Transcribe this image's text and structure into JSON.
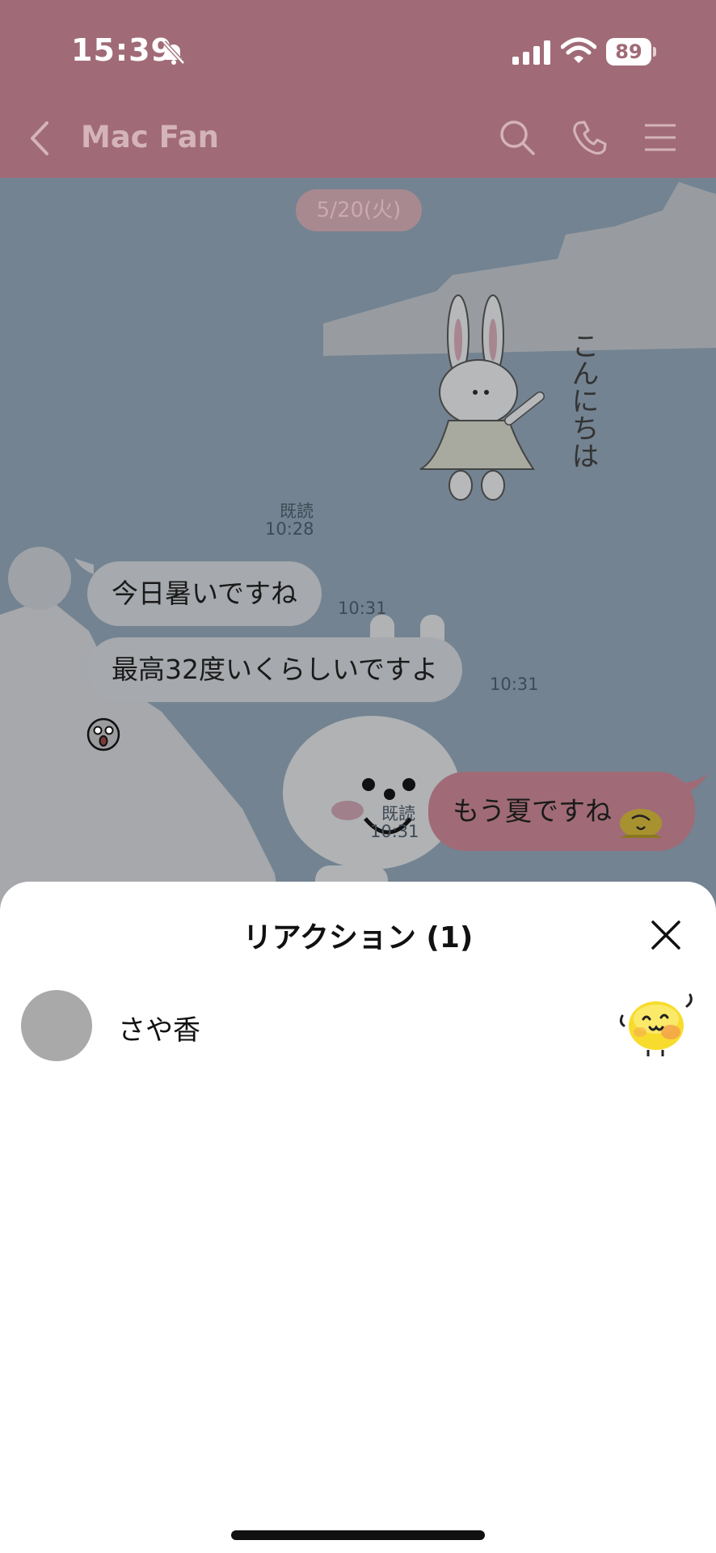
{
  "status_bar": {
    "time": "15:39",
    "battery": "89"
  },
  "header": {
    "title": "Mac Fan"
  },
  "chat": {
    "date_separator": "5/20(火)",
    "sticker_text": "こんにちは",
    "sticker_read": "既読",
    "sticker_time": "10:28",
    "messages": [
      {
        "text": "今日暑いですね",
        "time": "10:31"
      },
      {
        "text": "最高32度いくらしいですよ",
        "time": "10:31"
      }
    ],
    "my_message": {
      "text": "もう夏ですね",
      "read": "既読",
      "time": "10:31"
    }
  },
  "reaction_sheet": {
    "title": "リアクション (1)",
    "reactors": [
      {
        "name": "さや香",
        "reaction": "yellow-blob-sticker-icon"
      }
    ]
  },
  "colors": {
    "header_bg": "#a06b76",
    "chat_bg": "#738391",
    "incoming_bubble": "#a6a9ad",
    "outgoing_bubble": "#a06b76"
  }
}
